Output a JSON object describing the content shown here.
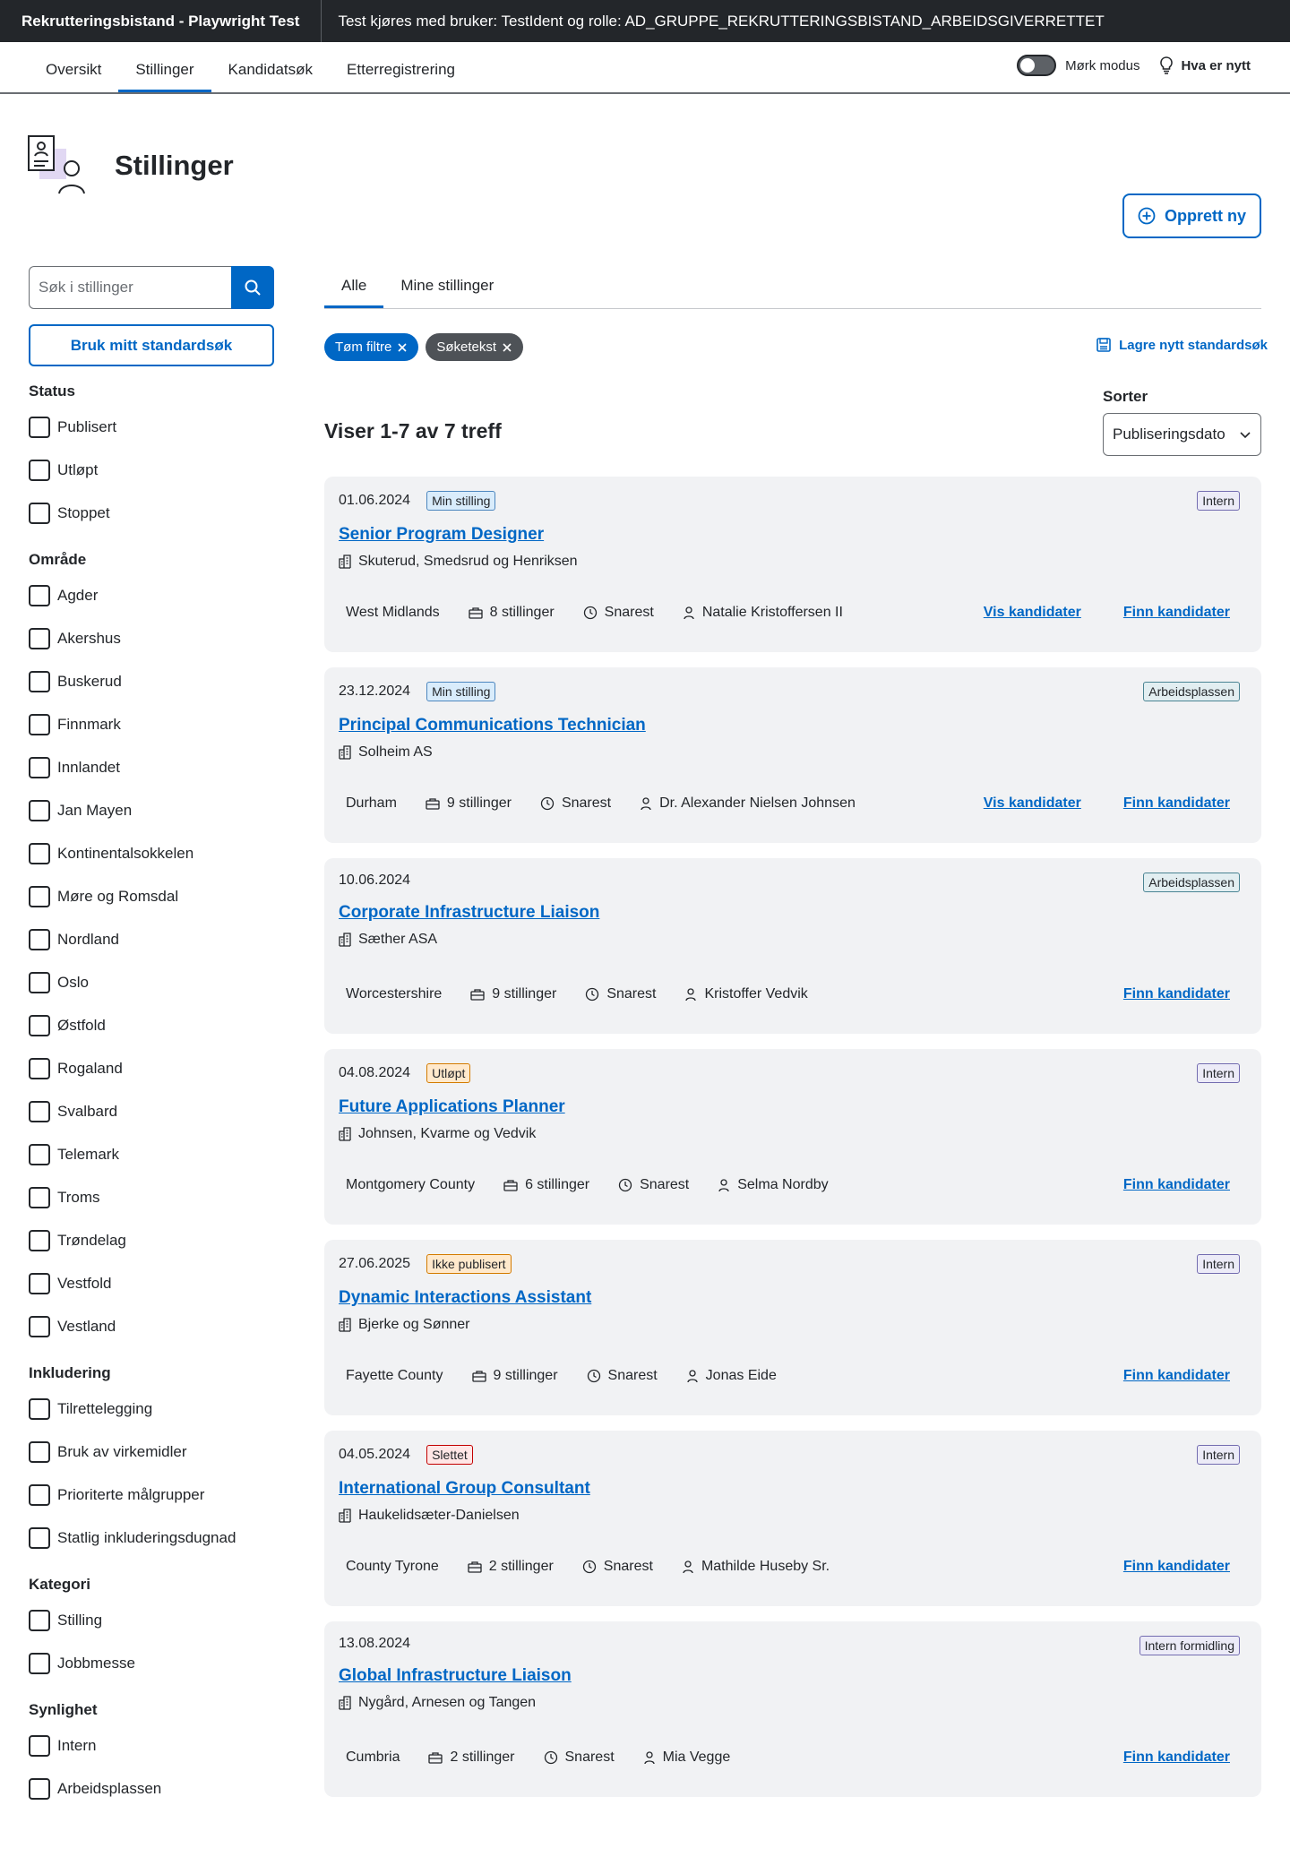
{
  "topbar": {
    "brand": "Rekrutteringsbistand - Playwright Test",
    "info": "Test kjøres med bruker: TestIdent og rolle: AD_GRUPPE_REKRUTTERINGSBISTAND_ARBEIDSGIVERRETTET"
  },
  "nav": {
    "tabs": [
      {
        "label": "Oversikt"
      },
      {
        "label": "Stillinger"
      },
      {
        "label": "Kandidatsøk"
      },
      {
        "label": "Etterregistrering"
      }
    ],
    "active_tab": "Stillinger",
    "dark_mode_label": "Mørk modus",
    "whats_new_label": "Hva er nytt"
  },
  "page": {
    "title": "Stillinger",
    "create_button": "Opprett ny"
  },
  "sidebar": {
    "search_placeholder": "Søk i stillinger",
    "standard_search_button": "Bruk mitt standardsøk",
    "groups": [
      {
        "title": "Status",
        "options": [
          "Publisert",
          "Utløpt",
          "Stoppet"
        ]
      },
      {
        "title": "Område",
        "options": [
          "Agder",
          "Akershus",
          "Buskerud",
          "Finnmark",
          "Innlandet",
          "Jan Mayen",
          "Kontinentalsokkelen",
          "Møre og Romsdal",
          "Nordland",
          "Oslo",
          "Østfold",
          "Rogaland",
          "Svalbard",
          "Telemark",
          "Troms",
          "Trøndelag",
          "Vestfold",
          "Vestland"
        ]
      },
      {
        "title": "Inkludering",
        "options": [
          "Tilrettelegging",
          "Bruk av virkemidler",
          "Prioriterte målgrupper",
          "Statlig inkluderingsdugnad"
        ]
      },
      {
        "title": "Kategori",
        "options": [
          "Stilling",
          "Jobbmesse"
        ]
      },
      {
        "title": "Synlighet",
        "options": [
          "Intern",
          "Arbeidsplassen"
        ]
      }
    ]
  },
  "main": {
    "tabs": [
      {
        "label": "Alle"
      },
      {
        "label": "Mine stillinger"
      }
    ],
    "chips": {
      "clear": "Tøm filtre",
      "search_text": "Søketekst"
    },
    "save_search": "Lagre nytt standardsøk",
    "result_count": "Viser 1-7 av 7 treff",
    "sort_label": "Sorter",
    "sort_value": "Publiseringsdato",
    "view_candidates": "Vis kandidater",
    "find_candidates": "Finn kandidater",
    "cards": [
      {
        "date": "01.06.2024",
        "status": "Min stilling",
        "status_kind": "min",
        "visibility": "Intern",
        "visibility_kind": "vis",
        "title": "Senior Program Designer",
        "employer": "Skuterud, Smedsrud og Henriksen",
        "location": "West Midlands",
        "positions": "8 stillinger",
        "deadline": "Snarest",
        "owner": "Natalie Kristoffersen II",
        "show_view": true
      },
      {
        "date": "23.12.2024",
        "status": "Min stilling",
        "status_kind": "min",
        "visibility": "Arbeidsplassen",
        "visibility_kind": "arb",
        "title": "Principal Communications Technician",
        "employer": "Solheim AS",
        "location": "Durham",
        "positions": "9 stillinger",
        "deadline": "Snarest",
        "owner": "Dr. Alexander Nielsen Johnsen",
        "show_view": true
      },
      {
        "date": "10.06.2024",
        "status": "",
        "status_kind": "",
        "visibility": "Arbeidsplassen",
        "visibility_kind": "arb",
        "title": "Corporate Infrastructure Liaison",
        "employer": "Sæther ASA",
        "location": "Worcestershire",
        "positions": "9 stillinger",
        "deadline": "Snarest",
        "owner": "Kristoffer Vedvik",
        "show_view": false
      },
      {
        "date": "04.08.2024",
        "status": "Utløpt",
        "status_kind": "utlopt",
        "visibility": "Intern",
        "visibility_kind": "vis",
        "title": "Future Applications Planner",
        "employer": "Johnsen, Kvarme og Vedvik",
        "location": "Montgomery County",
        "positions": "6 stillinger",
        "deadline": "Snarest",
        "owner": "Selma Nordby",
        "show_view": false
      },
      {
        "date": "27.06.2025",
        "status": "Ikke publisert",
        "status_kind": "ikke",
        "visibility": "Intern",
        "visibility_kind": "vis",
        "title": "Dynamic Interactions Assistant",
        "employer": "Bjerke og Sønner",
        "location": "Fayette County",
        "positions": "9 stillinger",
        "deadline": "Snarest",
        "owner": "Jonas Eide",
        "show_view": false
      },
      {
        "date": "04.05.2024",
        "status": "Slettet",
        "status_kind": "slettet",
        "visibility": "Intern",
        "visibility_kind": "vis",
        "title": "International Group Consultant",
        "employer": "Haukelidsæter-Danielsen",
        "location": "County Tyrone",
        "positions": "2 stillinger",
        "deadline": "Snarest",
        "owner": "Mathilde Huseby Sr.",
        "show_view": false
      },
      {
        "date": "13.08.2024",
        "status": "",
        "status_kind": "",
        "visibility": "Intern formidling",
        "visibility_kind": "vis",
        "title": "Global Infrastructure Liaison",
        "employer": "Nygård, Arnesen og Tangen",
        "location": "Cumbria",
        "positions": "2 stillinger",
        "deadline": "Snarest",
        "owner": "Mia Vegge",
        "show_view": false
      }
    ]
  },
  "colors": {
    "accent": "#0067c5",
    "topbar": "#23262a",
    "card_bg": "#f1f2f4"
  }
}
